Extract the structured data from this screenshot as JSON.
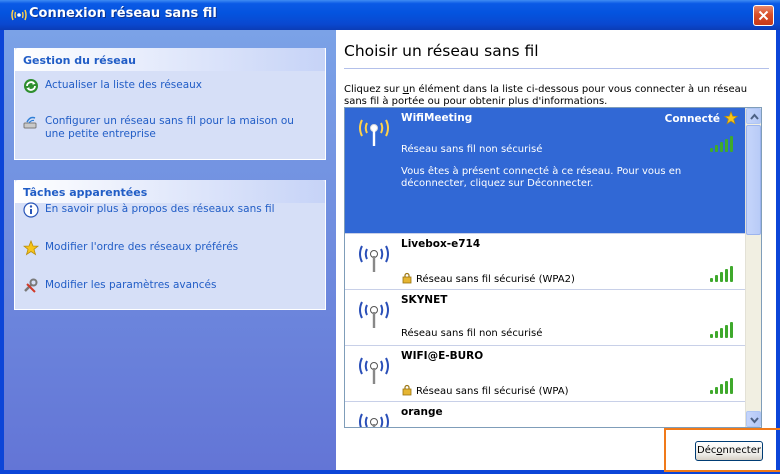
{
  "window": {
    "title": "Connexion réseau sans fil"
  },
  "left_pane": {
    "network_tasks": {
      "header": "Gestion du réseau",
      "items": [
        {
          "label": "Actualiser la liste des réseaux",
          "icon": "refresh-icon"
        },
        {
          "label": "Configurer un réseau sans fil pour la maison ou une petite entreprise",
          "icon": "setup-wizard-icon"
        }
      ]
    },
    "related_tasks": {
      "header": "Tâches apparentées",
      "items": [
        {
          "label": "En savoir plus à propos des réseaux sans fil",
          "icon": "info-icon"
        },
        {
          "label": "Modifier l'ordre des réseaux préférés",
          "icon": "star-icon"
        },
        {
          "label": "Modifier les paramètres avancés",
          "icon": "settings-icon"
        }
      ]
    }
  },
  "right_pane": {
    "heading": "Choisir un réseau sans fil",
    "intro_before_u": "Cliquez sur ",
    "intro_u": "u",
    "intro_after_u": "n élément dans la liste ci-dessous pour vous connecter à un réseau sans fil à portée ou pour obtenir plus d'informations."
  },
  "networks": [
    {
      "name": "WifiMeeting",
      "status": "Connecté",
      "security": "Réseau sans fil non sécurisé",
      "secured": false,
      "signal_bars": 5,
      "selected": true,
      "description": "Vous êtes à présent connecté à ce réseau. Pour vous en déconnecter, cliquez sur Déconnecter."
    },
    {
      "name": "Livebox-e714",
      "security": "Réseau sans fil sécurisé (WPA2)",
      "secured": true,
      "signal_bars": 5
    },
    {
      "name": "SKYNET",
      "security": "Réseau sans fil non sécurisé",
      "secured": false,
      "signal_bars": 5
    },
    {
      "name": "WIFI@E-BURO",
      "security": "Réseau sans fil sécurisé (WPA)",
      "secured": true,
      "signal_bars": 5
    },
    {
      "name": "orange"
    }
  ],
  "buttons": {
    "disconnect_before_o": "Déc",
    "disconnect_o": "o",
    "disconnect_after_o": "nnecter"
  },
  "colors": {
    "title_bar": "#0453de",
    "selected_row": "#3168d5",
    "link": "#215dc6",
    "signal": "#3fa92c",
    "highlight_box": "#f07a1a"
  }
}
